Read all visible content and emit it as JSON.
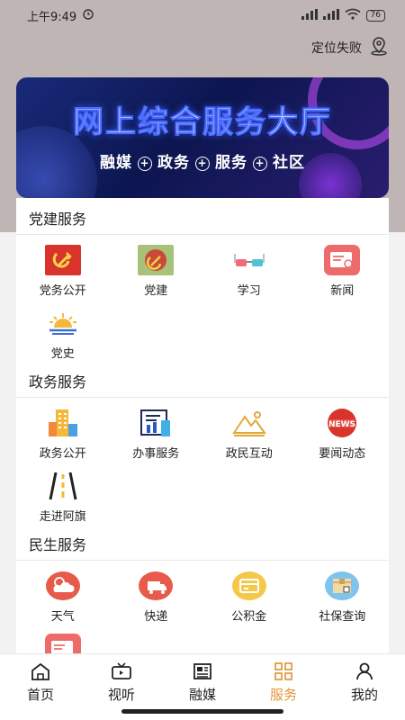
{
  "status": {
    "time": "上午9:49",
    "battery": "76"
  },
  "location": {
    "label": "定位失败"
  },
  "banner": {
    "title": "网上综合服务大厅",
    "tags": [
      "融媒",
      "政务",
      "服务",
      "社区"
    ]
  },
  "sections": [
    {
      "title": "党建服务",
      "items": [
        {
          "label": "党务公开",
          "icon": "party-flag-icon"
        },
        {
          "label": "党建",
          "icon": "party-emblem-icon"
        },
        {
          "label": "学习",
          "icon": "glasses-icon"
        },
        {
          "label": "新闻",
          "icon": "news-icon"
        },
        {
          "label": "党史",
          "icon": "sunrise-icon"
        }
      ]
    },
    {
      "title": "政务服务",
      "items": [
        {
          "label": "政务公开",
          "icon": "buildings-icon"
        },
        {
          "label": "办事服务",
          "icon": "office-chart-icon"
        },
        {
          "label": "政民互动",
          "icon": "mountain-icon"
        },
        {
          "label": "要闻动态",
          "icon": "news-badge-icon"
        },
        {
          "label": "走进阿旗",
          "icon": "road-icon"
        }
      ]
    },
    {
      "title": "民生服务",
      "items": [
        {
          "label": "天气",
          "icon": "weather-icon"
        },
        {
          "label": "快递",
          "icon": "delivery-icon"
        },
        {
          "label": "公积金",
          "icon": "card-icon"
        },
        {
          "label": "社保查询",
          "icon": "package-icon"
        }
      ]
    }
  ],
  "nav": [
    {
      "label": "首页",
      "icon": "home-icon",
      "active": false
    },
    {
      "label": "视听",
      "icon": "tv-icon",
      "active": false
    },
    {
      "label": "融媒",
      "icon": "newspaper-icon",
      "active": false
    },
    {
      "label": "服务",
      "icon": "grid-icon",
      "active": true
    },
    {
      "label": "我的",
      "icon": "user-icon",
      "active": false
    }
  ],
  "colors": {
    "accent": "#e0973a",
    "party_red": "#d9342b",
    "gov_blue": "#2b59c3"
  }
}
